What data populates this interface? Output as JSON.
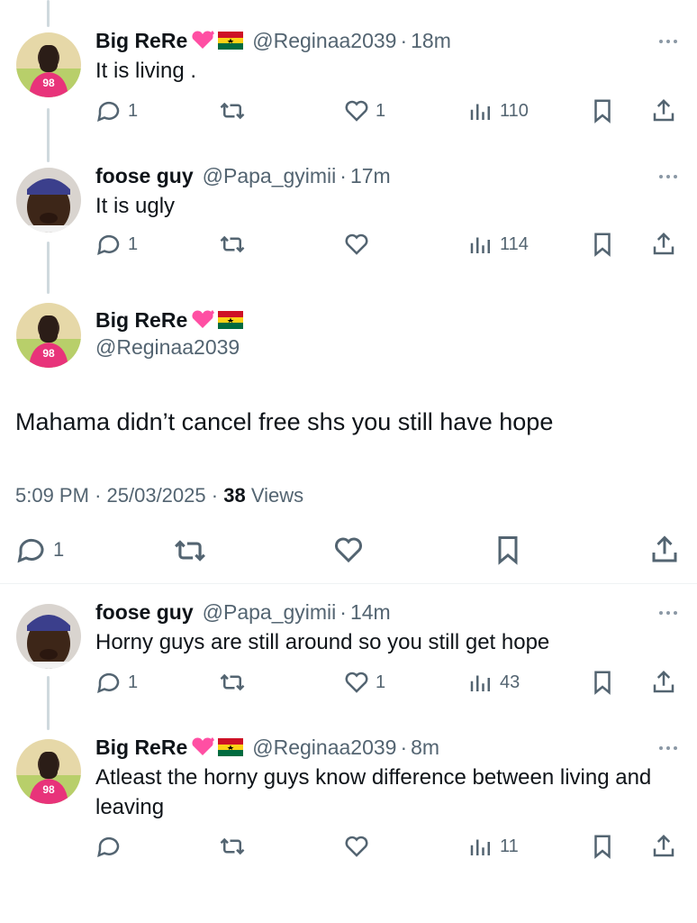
{
  "colors": {
    "text": "#0f1419",
    "muted": "#536471",
    "divider": "#eff3f4",
    "thread": "#cfd9de"
  },
  "tweets": [
    {
      "name": "Big ReRe",
      "emoji": [
        "heart-icon",
        "ghana-flag-icon"
      ],
      "handle": "@Reginaa2039",
      "dot": "·",
      "time": "18m",
      "text": "It is living .",
      "replies": "1",
      "retweets": "",
      "likes": "1",
      "views": "110"
    },
    {
      "name": "foose guy",
      "emoji": [],
      "handle": "@Papa_gyimii",
      "dot": "·",
      "time": "17m",
      "text": "It is ugly",
      "replies": "1",
      "retweets": "",
      "likes": "",
      "views": "114"
    },
    {
      "name": "foose guy",
      "emoji": [],
      "handle": "@Papa_gyimii",
      "dot": "·",
      "time": "14m",
      "text": "Horny guys are still around so you still get hope",
      "replies": "1",
      "retweets": "",
      "likes": "1",
      "views": "43"
    },
    {
      "name": "Big ReRe",
      "emoji": [
        "heart-icon",
        "ghana-flag-icon"
      ],
      "handle": "@Reginaa2039",
      "dot": "·",
      "time": "8m",
      "text": "Atleast the horny guys know difference between living and leaving",
      "replies": "",
      "retweets": "",
      "likes": "",
      "views": "11"
    }
  ],
  "main_tweet": {
    "name": "Big ReRe",
    "handle": "@Reginaa2039",
    "text": "Mahama didn’t cancel free shs you still have hope",
    "time": "5:09 PM",
    "date": "25/03/2025",
    "sep": "·",
    "views_count": "38",
    "views_label": "Views",
    "replies": "1"
  }
}
